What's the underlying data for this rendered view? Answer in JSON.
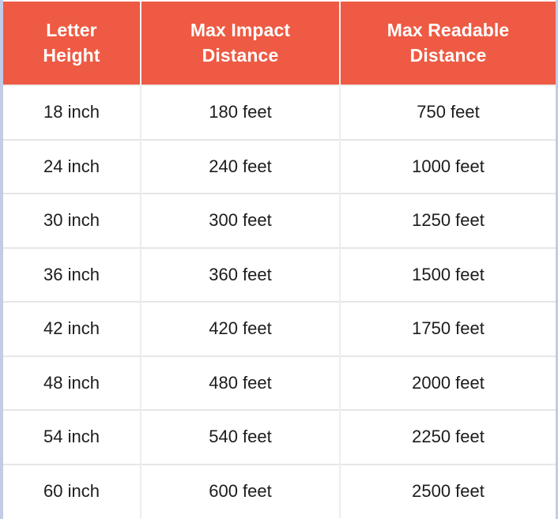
{
  "table": {
    "name": "letter-height-visibility-table",
    "columns": [
      {
        "key": "letter_height",
        "label_line1": "Letter",
        "label_line2": "Height"
      },
      {
        "key": "max_impact",
        "label_line1": "Max Impact",
        "label_line2": "Distance"
      },
      {
        "key": "max_readable",
        "label_line1": "Max Readable",
        "label_line2": "Distance"
      }
    ],
    "rows": [
      {
        "letter_height": "18 inch",
        "max_impact": "180 feet",
        "max_readable": "750 feet"
      },
      {
        "letter_height": "24 inch",
        "max_impact": "240 feet",
        "max_readable": "1000 feet"
      },
      {
        "letter_height": "30 inch",
        "max_impact": "300 feet",
        "max_readable": "1250 feet"
      },
      {
        "letter_height": "36 inch",
        "max_impact": "360 feet",
        "max_readable": "1500 feet"
      },
      {
        "letter_height": "42 inch",
        "max_impact": "420 feet",
        "max_readable": "1750 feet"
      },
      {
        "letter_height": "48 inch",
        "max_impact": "480 feet",
        "max_readable": "2000 feet"
      },
      {
        "letter_height": "54 inch",
        "max_impact": "540 feet",
        "max_readable": "2250 feet"
      },
      {
        "letter_height": "60 inch",
        "max_impact": "600 feet",
        "max_readable": "2500 feet"
      }
    ]
  },
  "colors": {
    "header_background": "#ee5a43",
    "header_text": "#ffffff",
    "body_text": "#1c1c1c",
    "row_divider": "#e6e6e6",
    "column_divider": "#ededed",
    "edge_rail": "#c3cbe6",
    "page_background": "#ffffff"
  }
}
